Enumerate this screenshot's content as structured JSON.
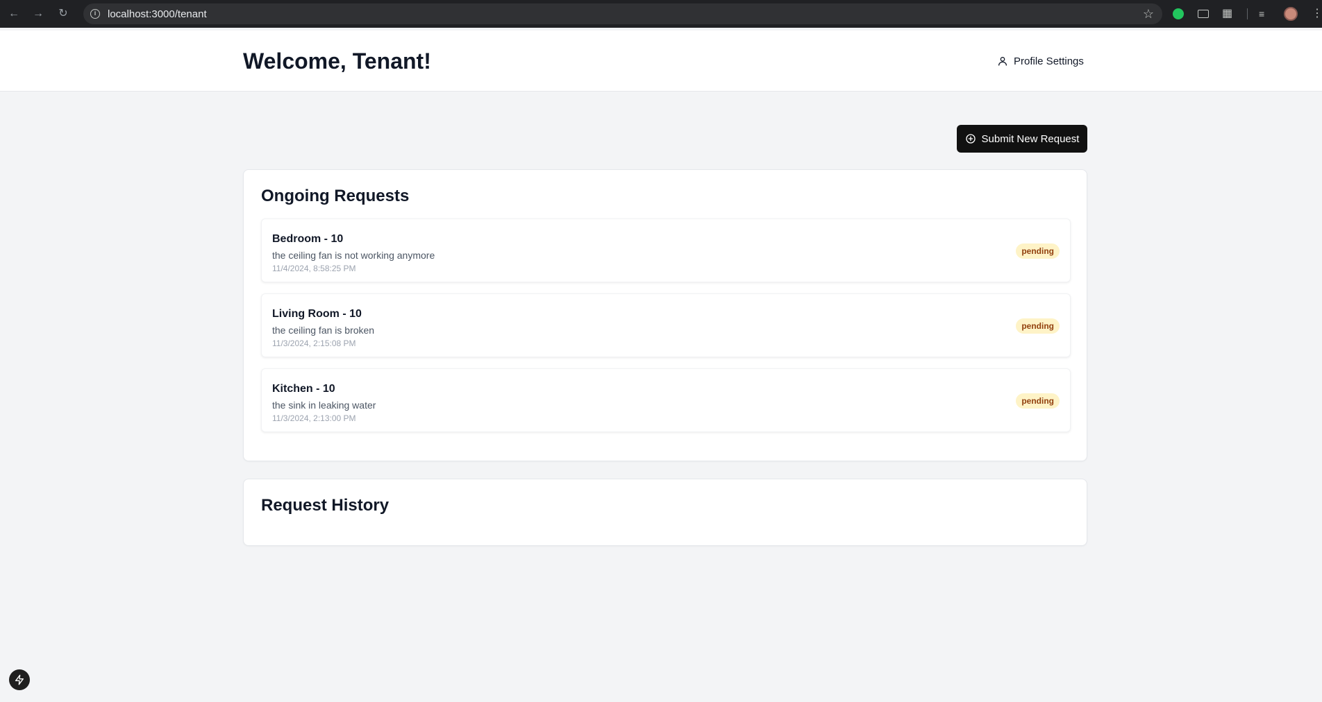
{
  "browser": {
    "url": "localhost:3000/tenant",
    "icons": [
      "back-icon",
      "forward-icon",
      "reload-icon",
      "info-icon",
      "star-icon",
      "extension-icon",
      "puzzle-icon",
      "media-icon",
      "avatar",
      "menu-icon"
    ]
  },
  "header": {
    "title": "Welcome, Tenant!",
    "profile_label": "Profile Settings"
  },
  "actions": {
    "submit_label": "Submit New Request"
  },
  "ongoing": {
    "title": "Ongoing Requests",
    "items": [
      {
        "title": "Bedroom - 10",
        "description": "the ceiling fan is not working anymore",
        "date": "11/4/2024, 8:58:25 PM",
        "status": "pending"
      },
      {
        "title": "Living Room - 10",
        "description": "the ceiling fan is broken",
        "date": "11/3/2024, 2:15:08 PM",
        "status": "pending"
      },
      {
        "title": "Kitchen - 10",
        "description": "the sink in leaking water",
        "date": "11/3/2024, 2:13:00 PM",
        "status": "pending"
      }
    ]
  },
  "history": {
    "title": "Request History"
  },
  "colors": {
    "accent": "#111111",
    "badge_bg": "#fef3c7",
    "badge_text": "#92400e",
    "page_bg": "#f3f4f6"
  }
}
